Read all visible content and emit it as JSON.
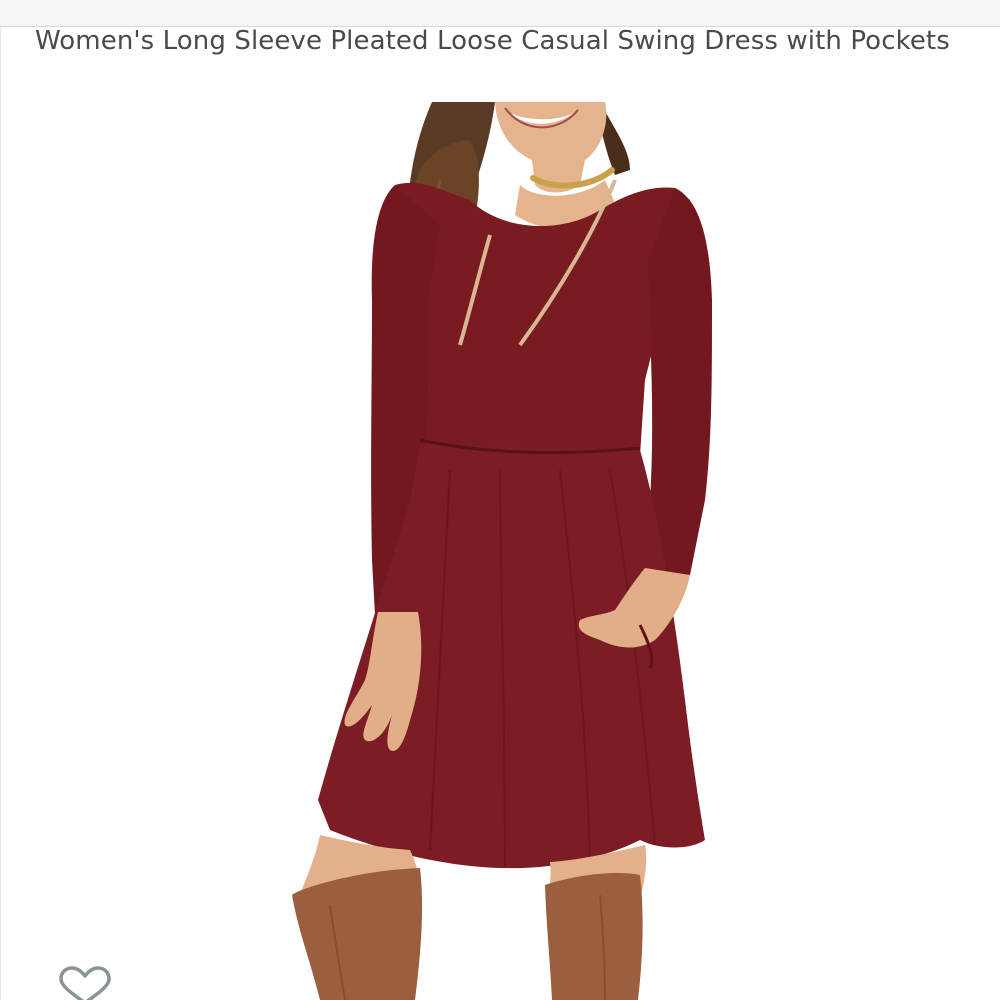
{
  "product": {
    "title": "Women's Long Sleeve Pleated Loose Casual Swing Dress with Pockets",
    "image_alt": "Woman wearing a burgundy long sleeve swing dress with pockets and brown knee-high boots"
  },
  "actions": {
    "wishlist_icon": "heart-outline-icon"
  },
  "colors": {
    "dress": "#7a1b22",
    "boots": "#9b5e3e",
    "title_text": "#4a4a4a",
    "icon_stroke": "#8a9494"
  }
}
